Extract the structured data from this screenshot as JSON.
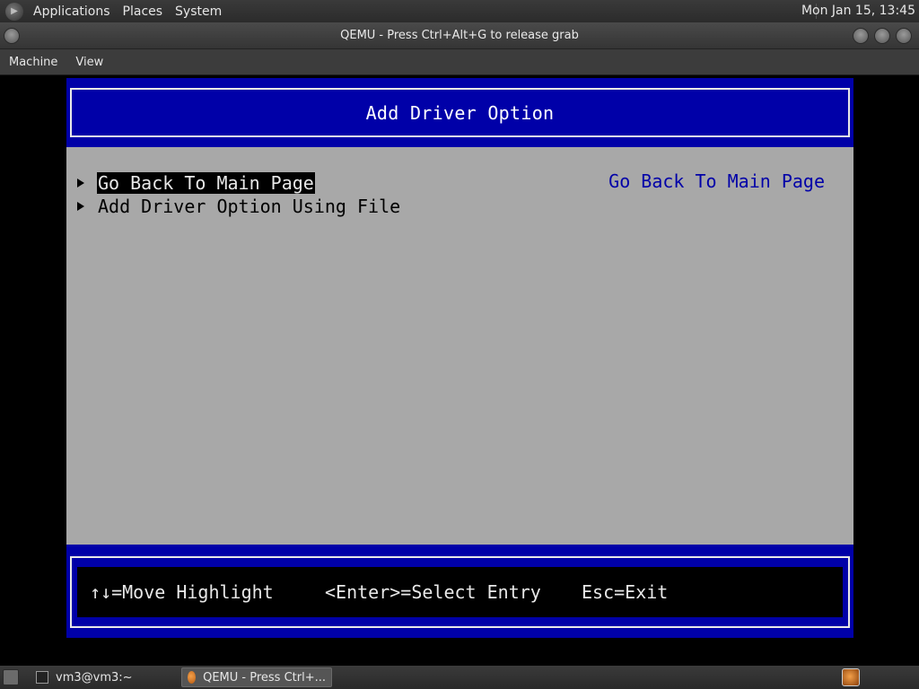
{
  "top_panel": {
    "menus": [
      "Applications",
      "Places",
      "System"
    ],
    "clock": "Mon Jan 15, 13:45"
  },
  "window": {
    "title": "QEMU - Press Ctrl+Alt+G to release grab"
  },
  "menubar": {
    "items": [
      "Machine",
      "View"
    ]
  },
  "bios": {
    "header_title": "Add Driver Option",
    "menu_items": [
      {
        "label": "Go Back To Main Page",
        "selected": true
      },
      {
        "label": "Add Driver Option Using File",
        "selected": false
      }
    ],
    "help_text": "Go Back To Main Page",
    "footer_hints": [
      "↑↓=Move Highlight",
      "<Enter>=Select Entry",
      "Esc=Exit"
    ],
    "colors": {
      "blue": "#0000a8",
      "gray": "#a8a8a8",
      "black": "#000000",
      "white": "#e8e8e8"
    }
  },
  "taskbar": {
    "tasks": [
      {
        "label": "vm3@vm3:~",
        "icon": "terminal-icon",
        "active": false
      },
      {
        "label": "QEMU - Press Ctrl+...",
        "icon": "qemu-icon",
        "active": true
      }
    ]
  }
}
